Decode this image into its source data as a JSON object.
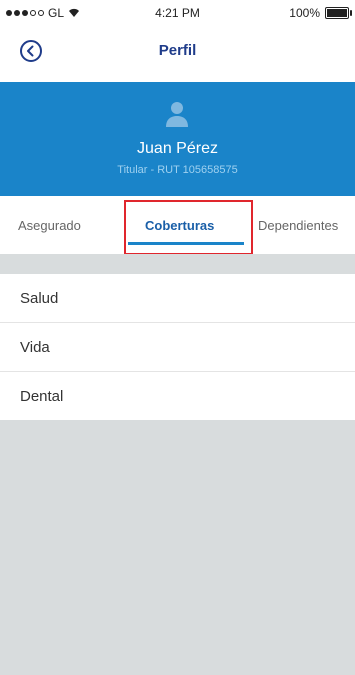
{
  "status_bar": {
    "carrier": "GL",
    "time": "4:21 PM",
    "battery": "100%",
    "battery_level": 1.0
  },
  "nav": {
    "title": "Perfil"
  },
  "profile": {
    "name": "Juan Pérez",
    "subtitle": "Titular - RUT 105658575"
  },
  "tabs": [
    {
      "label": "Asegurado"
    },
    {
      "label": "Coberturas"
    },
    {
      "label": "Dependientes"
    }
  ],
  "active_tab": "Coberturas",
  "coverages": [
    {
      "label": "Salud"
    },
    {
      "label": "Vida"
    },
    {
      "label": "Dental"
    }
  ],
  "colors": {
    "header_blue": "#1a84c9",
    "title_blue": "#1f3c8a",
    "highlight_red": "#e0262d",
    "background": "#d8dcdd"
  }
}
